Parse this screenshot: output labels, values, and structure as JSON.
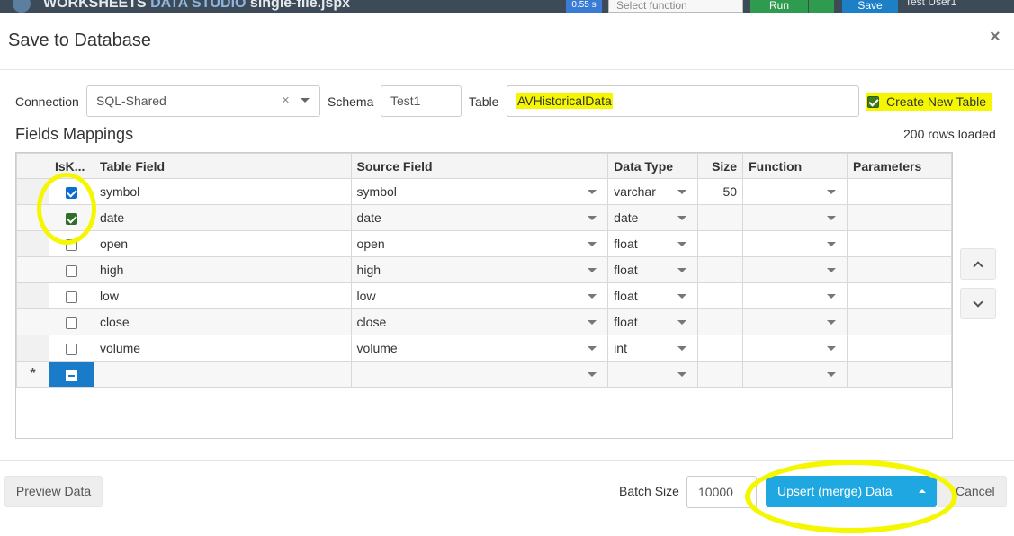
{
  "app": {
    "title_part1": "WORKSHEETS ",
    "title_part2": "DATA STUDIO",
    "title_part3": " single-file.jspx",
    "badge": "0.55 s",
    "function_placeholder": "Select function",
    "run_label": "Run",
    "save_label": "Save",
    "user": "Test User1"
  },
  "modal": {
    "title": "Save to Database",
    "close": "×",
    "connection_label": "Connection",
    "connection_value": "SQL-Shared",
    "connection_clear": "×",
    "schema_label": "Schema",
    "schema_value": "Test1",
    "table_label": "Table",
    "table_value": "AVHistoricalData",
    "create_new_label": "Create New Table",
    "create_new_checked": true,
    "section_title": "Fields Mappings",
    "rows_loaded": "200 rows loaded"
  },
  "grid": {
    "columns": [
      "IsK...",
      "Table Field",
      "Source Field",
      "Data Type",
      "Size",
      "Function",
      "Parameters"
    ],
    "rows": [
      {
        "is_key": true,
        "table_field": "symbol",
        "source_field": "symbol",
        "data_type": "varchar",
        "size": "50",
        "function": "",
        "parameters": ""
      },
      {
        "is_key": true,
        "table_field": "date",
        "source_field": "date",
        "data_type": "date",
        "size": "",
        "function": "",
        "parameters": ""
      },
      {
        "is_key": false,
        "table_field": "open",
        "source_field": "open",
        "data_type": "float",
        "size": "",
        "function": "",
        "parameters": ""
      },
      {
        "is_key": false,
        "table_field": "high",
        "source_field": "high",
        "data_type": "float",
        "size": "",
        "function": "",
        "parameters": ""
      },
      {
        "is_key": false,
        "table_field": "low",
        "source_field": "low",
        "data_type": "float",
        "size": "",
        "function": "",
        "parameters": ""
      },
      {
        "is_key": false,
        "table_field": "close",
        "source_field": "close",
        "data_type": "float",
        "size": "",
        "function": "",
        "parameters": ""
      },
      {
        "is_key": false,
        "table_field": "volume",
        "source_field": "volume",
        "data_type": "int",
        "size": "",
        "function": "",
        "parameters": ""
      }
    ],
    "new_row_marker": "*"
  },
  "footer": {
    "preview_label": "Preview Data",
    "batch_label": "Batch Size",
    "batch_value": "10000",
    "upsert_label": "Upsert (merge) Data",
    "cancel_label": "Cancel"
  },
  "colors": {
    "highlight": "#f4f700",
    "primary": "#1ea7e1",
    "checkbox": "#0a6ed1"
  }
}
